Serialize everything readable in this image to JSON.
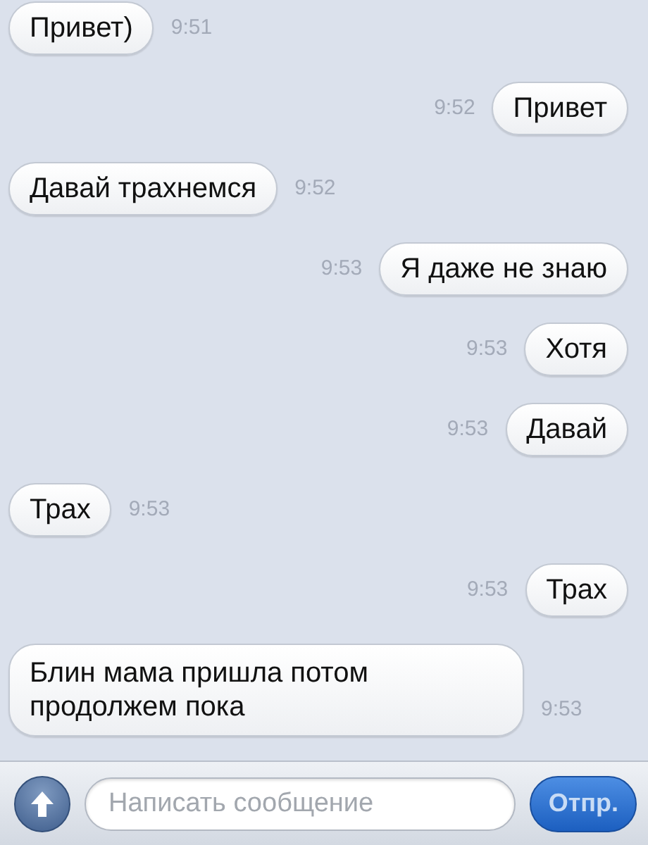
{
  "messages": [
    {
      "kind": "incoming",
      "text": "Привет)",
      "time": "9:51"
    },
    {
      "kind": "outgoing",
      "text": "Привет",
      "time": "9:52"
    },
    {
      "kind": "incoming",
      "text": "Давай трахнемся",
      "time": "9:52"
    },
    {
      "kind": "outgoing",
      "text": "Я даже не знаю",
      "time": "9:53"
    },
    {
      "kind": "outgoing",
      "text": "Хотя",
      "time": "9:53"
    },
    {
      "kind": "outgoing",
      "text": "Давай",
      "time": "9:53"
    },
    {
      "kind": "incoming",
      "text": "Трах",
      "time": "9:53"
    },
    {
      "kind": "outgoing",
      "text": "Трах",
      "time": "9:53"
    },
    {
      "kind": "incoming",
      "text": "Блин мама пришла потом продолжем пока",
      "time": "9:53"
    }
  ],
  "composer": {
    "placeholder": "Написать сообщение",
    "send_label": "Отпр."
  }
}
